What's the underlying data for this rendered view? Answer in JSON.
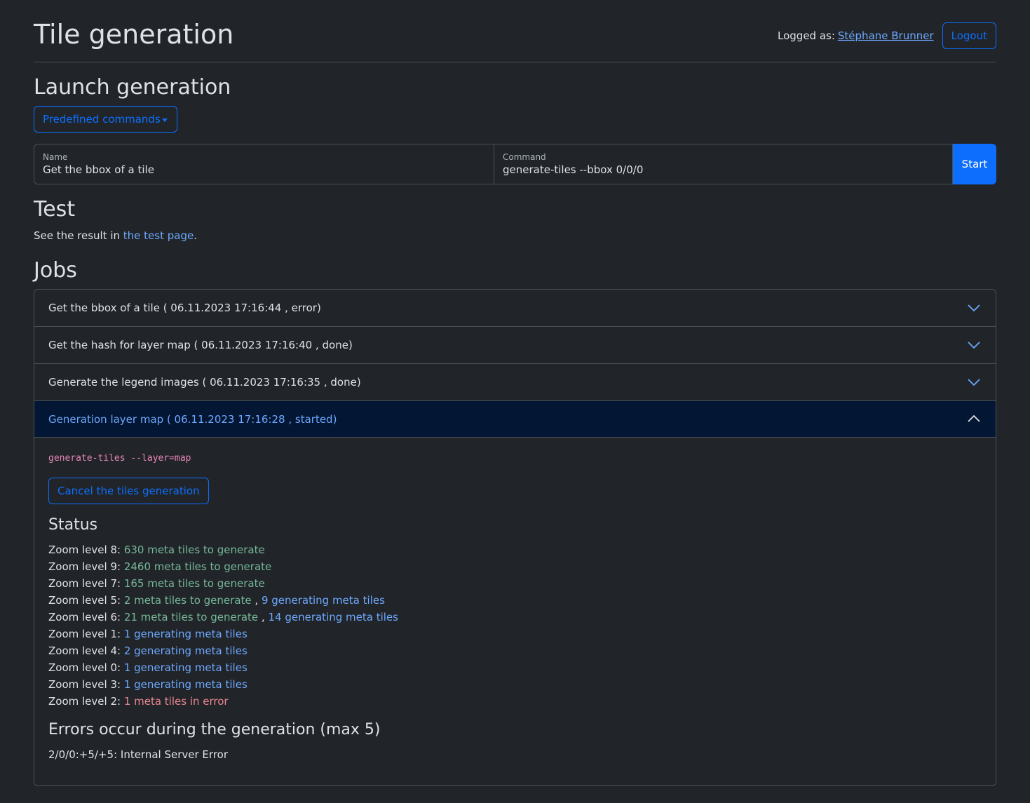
{
  "header": {
    "title": "Tile generation",
    "logged_as_label": "Logged as:",
    "user_name": "Stéphane Brunner",
    "logout_label": "Logout"
  },
  "launch": {
    "heading": "Launch generation",
    "predefined_label": "Predefined commands",
    "name_label": "Name",
    "name_value": "Get the bbox of a tile",
    "command_label": "Command",
    "command_value": "generate-tiles --bbox 0/0/0",
    "start_label": "Start"
  },
  "test": {
    "heading": "Test",
    "text_before": "See the result in ",
    "link_text": "the test page",
    "text_after": "."
  },
  "jobs": {
    "heading": "Jobs",
    "items": [
      {
        "label": "Get the bbox of a tile ( 06.11.2023 17:16:44 , error)"
      },
      {
        "label": "Get the hash for layer map ( 06.11.2023 17:16:40 , done)"
      },
      {
        "label": "Generate the legend images ( 06.11.2023 17:16:35 , done)"
      },
      {
        "label": "Generation layer map ( 06.11.2023 17:16:28 , started)"
      }
    ],
    "active": {
      "command": "generate-tiles --layer=map",
      "cancel_label": "Cancel the tiles generation",
      "status_heading": "Status",
      "status": [
        {
          "level": "Zoom level 8: ",
          "todo": "630 meta tiles to generate",
          "sep": "",
          "gen": "",
          "err": ""
        },
        {
          "level": "Zoom level 9: ",
          "todo": "2460 meta tiles to generate",
          "sep": "",
          "gen": "",
          "err": ""
        },
        {
          "level": "Zoom level 7: ",
          "todo": "165 meta tiles to generate",
          "sep": "",
          "gen": "",
          "err": ""
        },
        {
          "level": "Zoom level 5: ",
          "todo": "2 meta tiles to generate",
          "sep": " , ",
          "gen": "9 generating meta tiles",
          "err": ""
        },
        {
          "level": "Zoom level 6: ",
          "todo": "21 meta tiles to generate",
          "sep": " , ",
          "gen": "14 generating meta tiles",
          "err": ""
        },
        {
          "level": "Zoom level 1: ",
          "todo": "",
          "sep": "",
          "gen": "1 generating meta tiles",
          "err": ""
        },
        {
          "level": "Zoom level 4: ",
          "todo": "",
          "sep": "",
          "gen": "2 generating meta tiles",
          "err": ""
        },
        {
          "level": "Zoom level 0: ",
          "todo": "",
          "sep": "",
          "gen": "1 generating meta tiles",
          "err": ""
        },
        {
          "level": "Zoom level 3: ",
          "todo": "",
          "sep": "",
          "gen": "1 generating meta tiles",
          "err": ""
        },
        {
          "level": "Zoom level 2: ",
          "todo": "",
          "sep": "",
          "gen": "",
          "err": "1 meta tiles in error"
        }
      ],
      "errors_heading": "Errors occur during the generation (max 5)",
      "error_line": "2/0/0:+5/+5: Internal Server Error"
    }
  },
  "colors": {
    "background": "#212529",
    "accent": "#0d6efd",
    "link": "#6ea8fe",
    "todo": "#75b798",
    "error": "#ea868f"
  }
}
